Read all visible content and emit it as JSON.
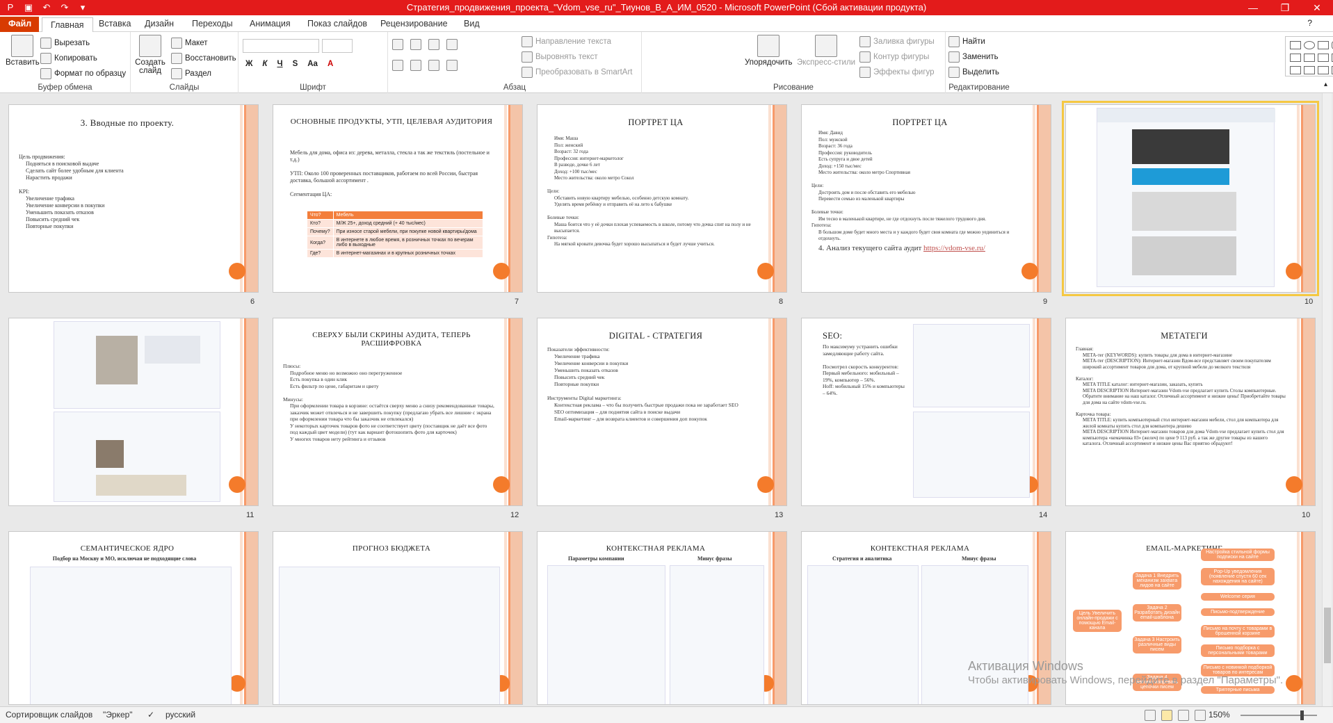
{
  "window": {
    "title": "Стратегия_продвижения_проекта_\"Vdom_vse_ru\"_Тиунов_В_А_ИМ_0520 - Microsoft PowerPoint (Сбой активации продукта)"
  },
  "tabs": [
    "Файл",
    "Главная",
    "Вставка",
    "Дизайн",
    "Переходы",
    "Анимация",
    "Показ слайдов",
    "Рецензирование",
    "Вид"
  ],
  "ribbon": {
    "clipboard": {
      "label": "Буфер обмена",
      "paste": "Вставить",
      "cut": "Вырезать",
      "copy": "Копировать",
      "format": "Формат по образцу"
    },
    "slides": {
      "label": "Слайды",
      "new": "Создать слайд",
      "layout": "Макет",
      "reset": "Восстановить",
      "section": "Раздел"
    },
    "font": {
      "label": "Шрифт"
    },
    "paragraph": {
      "label": "Абзац",
      "dir": "Направление текста",
      "align": "Выровнять текст",
      "smartart": "Преобразовать в SmartArt"
    },
    "drawing": {
      "label": "Рисование",
      "arrange": "Упорядочить",
      "styles": "Экспресс-стили",
      "fill": "Заливка фигуры",
      "outline": "Контур фигуры",
      "effects": "Эффекты фигур"
    },
    "editing": {
      "label": "Редактирование",
      "find": "Найти",
      "replace": "Заменить",
      "select": "Выделить"
    }
  },
  "slides": [
    {
      "n": "6",
      "title": "3. Вводные по проекту.",
      "lines": [
        "Цель продвижения:",
        "Подняться в поисковой выдаче",
        "Сделать сайт более удобным для клиента",
        "Нарастить продажи",
        "",
        "KPI:",
        "Увеличение трафика",
        "Увеличение конверсии в покупки",
        "Уменьшить показать отказов",
        "Повысить средний чек",
        "Повторные покупки"
      ]
    },
    {
      "n": "7",
      "title": "Основные продукты, УТП, целевая аудитория",
      "lines": [
        "Мебель для дома, офиса из: дерева, металла, стекла а так же текстиль (постельное и т.д.)",
        "",
        "УТП: Около 100 проверенных поставщиков, работаем по всей России, быстрая доставка, большой ассортимент .",
        "",
        "Сегментация ЦА:"
      ],
      "table": [
        [
          "Что?",
          "Мебель"
        ],
        [
          "Кто?",
          "М/Ж 25+, доход средний (+ 40 тыс/мес)"
        ],
        [
          "Почему?",
          "При износе старой мебели, при покупке новой квартиры/дома"
        ],
        [
          "Когда?",
          "В интернете в любое время, в розничных точках по вечерам либо в выходные"
        ],
        [
          "Где?",
          "В интернет-магазинах и в крупных розничных точках"
        ]
      ]
    },
    {
      "n": "8",
      "title": "Портрет ЦА",
      "lines": [
        "Имя: Маша",
        "Пол: женский",
        "Возраст: 32 года",
        "Профессия: интернет-маркетолог",
        "В разводе, дочке 6 лет",
        "Доход: +100 тыс/мес",
        "Место жительства: около метро Сокол",
        "",
        "Цели:",
        "Обставить новую квартиру мебелью, особенно детскую комнату.",
        "Уделять время ребёнку и отправить её на лето к бабушке",
        "",
        "Болевые точки:",
        "Маша боится что у её дочки плохая успеваемость в школе, потому что дочка спит на полу и не высыпается.",
        "Гипотеза:",
        "На мягкой кровати девочка будет хорошо высыпаться и будет лучше учиться."
      ]
    },
    {
      "n": "9",
      "title": "Портрет ЦА",
      "lines": [
        "Имя: Давид",
        "Пол: мужской",
        "Возраст: 36 года",
        "Профессия: руководитель",
        "Есть супруга и двое детей",
        "Доход: +150 тыс/мес",
        "Место жительства: около метро Спортивная",
        "",
        "Цели:",
        "Достроить дом и после обставить его мебелью",
        "Перевести семью из маленькой квартиры",
        "",
        "Болевые точки:",
        "Им тесно в маленькой квартире, не где отдохнуть после тяжелого трудового дня.",
        "Гипотеза:",
        "В большом доме будет много места и у каждого будет своя комната где можно уединиться и отдохнуть."
      ],
      "footer": "4. Анализ текущего сайта аудит",
      "link": "https://vdom-vse.ru/"
    },
    {
      "n": "10"
    },
    {
      "n": "11"
    },
    {
      "n": "12",
      "title": "Сверху были скрины аудита, теперь расшифровка",
      "lines": [
        "Плюсы:",
        "Подробное меню но возможно оно перегруженное",
        "Есть покупка в один клик",
        "Есть фильтр по цене, габаритам и цвету",
        "",
        "Минусы:",
        "При оформлении товара в корзине: остаётся сверху меню а снизу рекомендованные товары, заказчик может отвлечься и не завершить покупку (предлагаю убрать все лишние с экрана при оформлении товара что бы заказчик не отвлекался)",
        "У некоторых карточек товаров фото не соответствует цвету (поставщик не даёт все фото под каждый цвет модели) (тут как вариант фотошопить фото для карточек)",
        "У многих товаров нету рейтинга и отзывов"
      ]
    },
    {
      "n": "13",
      "title": "Digital - стратегия",
      "lines": [
        "Показатели эффективности:",
        "Увеличение трафика",
        "Увеличение конверсии в покупки",
        "Уменьшить показать отказов",
        "Повысить средний чек",
        "Повторные покупки",
        "",
        "Инструменты Digital маркетинга:",
        "Контекстная реклама – что бы получить быстрые продажи пока не заработает SEO",
        "SEO оптимизация – для поднятия сайта в поиске выдачи",
        "Email-маркетинг – для возврата клиентов и совершения доп покупок"
      ]
    },
    {
      "n": "14",
      "title": "SEO:",
      "lines": [
        "По максимуму устранить ошибки замедляющие работу сайта.",
        "",
        "Посмотрел скорость конкурентов:",
        "Первый мебельного: мобильный – 19%, компьютер – 56%.",
        "Hoff: мобильный 15% и компьютеры – 64%."
      ]
    },
    {
      "n": "15",
      "title": "Метатеги",
      "lines": [
        "Главная:",
        "META-тег (KEYWORDS): купить товары для дома в интернет-магазине",
        "META-тег (DESCRIPTION): Интернет-магазин Вдом-все представляет своим покупателям широкий ассортимент товаров для дома, от крупной мебели до мелкого текстиля",
        "",
        "Каталог:",
        "META TITLE каталог: интернет-магазин, заказать, купить",
        "META DESCRIPTION Интернет-магазин Vdom-vse предлагает купить Столы компьютерные. Обратите внимание на наш каталог. Отличный ассортимент и низкие цены! Приобретайте товары для дома на сайте vdom-vse.ru.",
        "",
        "Карточка товара:",
        "META TITLE: купить компьютерный стол интернет-магазин мебели, стол для компьютера для жилой комнаты купить стол для компьютера дешево",
        "META DESCRIPTION Интернет-магазин товаров для дома Vdom-vse предлагает купить стол для компьютера «кемачинка 03» (желеч) по цене 9 113 руб. а так же другие товары из нашего каталога. Отличный ассортимент и низкие цены Вас приятно обрадуют!"
      ]
    },
    {
      "n": "16",
      "title": "Семантическое ядро",
      "sub": "Подбор на Москву и МО, исключая не подходящие слова"
    },
    {
      "n": "17",
      "title": "Прогноз бюджета"
    },
    {
      "n": "18",
      "title": "Контекстная реклама",
      "sub1": "Параметры компании",
      "sub2": "Минус фразы"
    },
    {
      "n": "19",
      "title": "Контекстная реклама",
      "sub1": "Стратегия и аналитика",
      "sub2": "Минус фразы"
    },
    {
      "n": "20",
      "title": "Email-маркетинг",
      "goal": "Цель Увеличить онлайн-продажи с помощью Email-канала",
      "tasks": [
        "Задача 1 Внедрить механизм захвата лидов на сайте",
        "Задача 2 Разработать дизайн email-шаблона",
        "Задача 3 Настроить различные виды писем",
        "Задача 4 Автоматизировать цепочки писем"
      ],
      "leaves": [
        "Настройка стильной формы подписки на сайте",
        "Pop-Up уведомления (появление спустя 60 сек нахождения на сайте)",
        "Welcome серия",
        "Письмо-подтверждение",
        "Письмо на почту с товарами в брошенной корзине",
        "Письмо подборка с персональными товарами",
        "Письмо с новинкой подборкой товаров по интересам",
        "Триггерные письма"
      ]
    }
  ],
  "activation": {
    "title": "Активация Windows",
    "sub": "Чтобы активировать Windows, перейдите в раздел \"Параметры\"."
  },
  "status": {
    "view": "Сортировщик слайдов",
    "theme": "\"Эркер\"",
    "lang": "русский",
    "zoom": "150%"
  }
}
